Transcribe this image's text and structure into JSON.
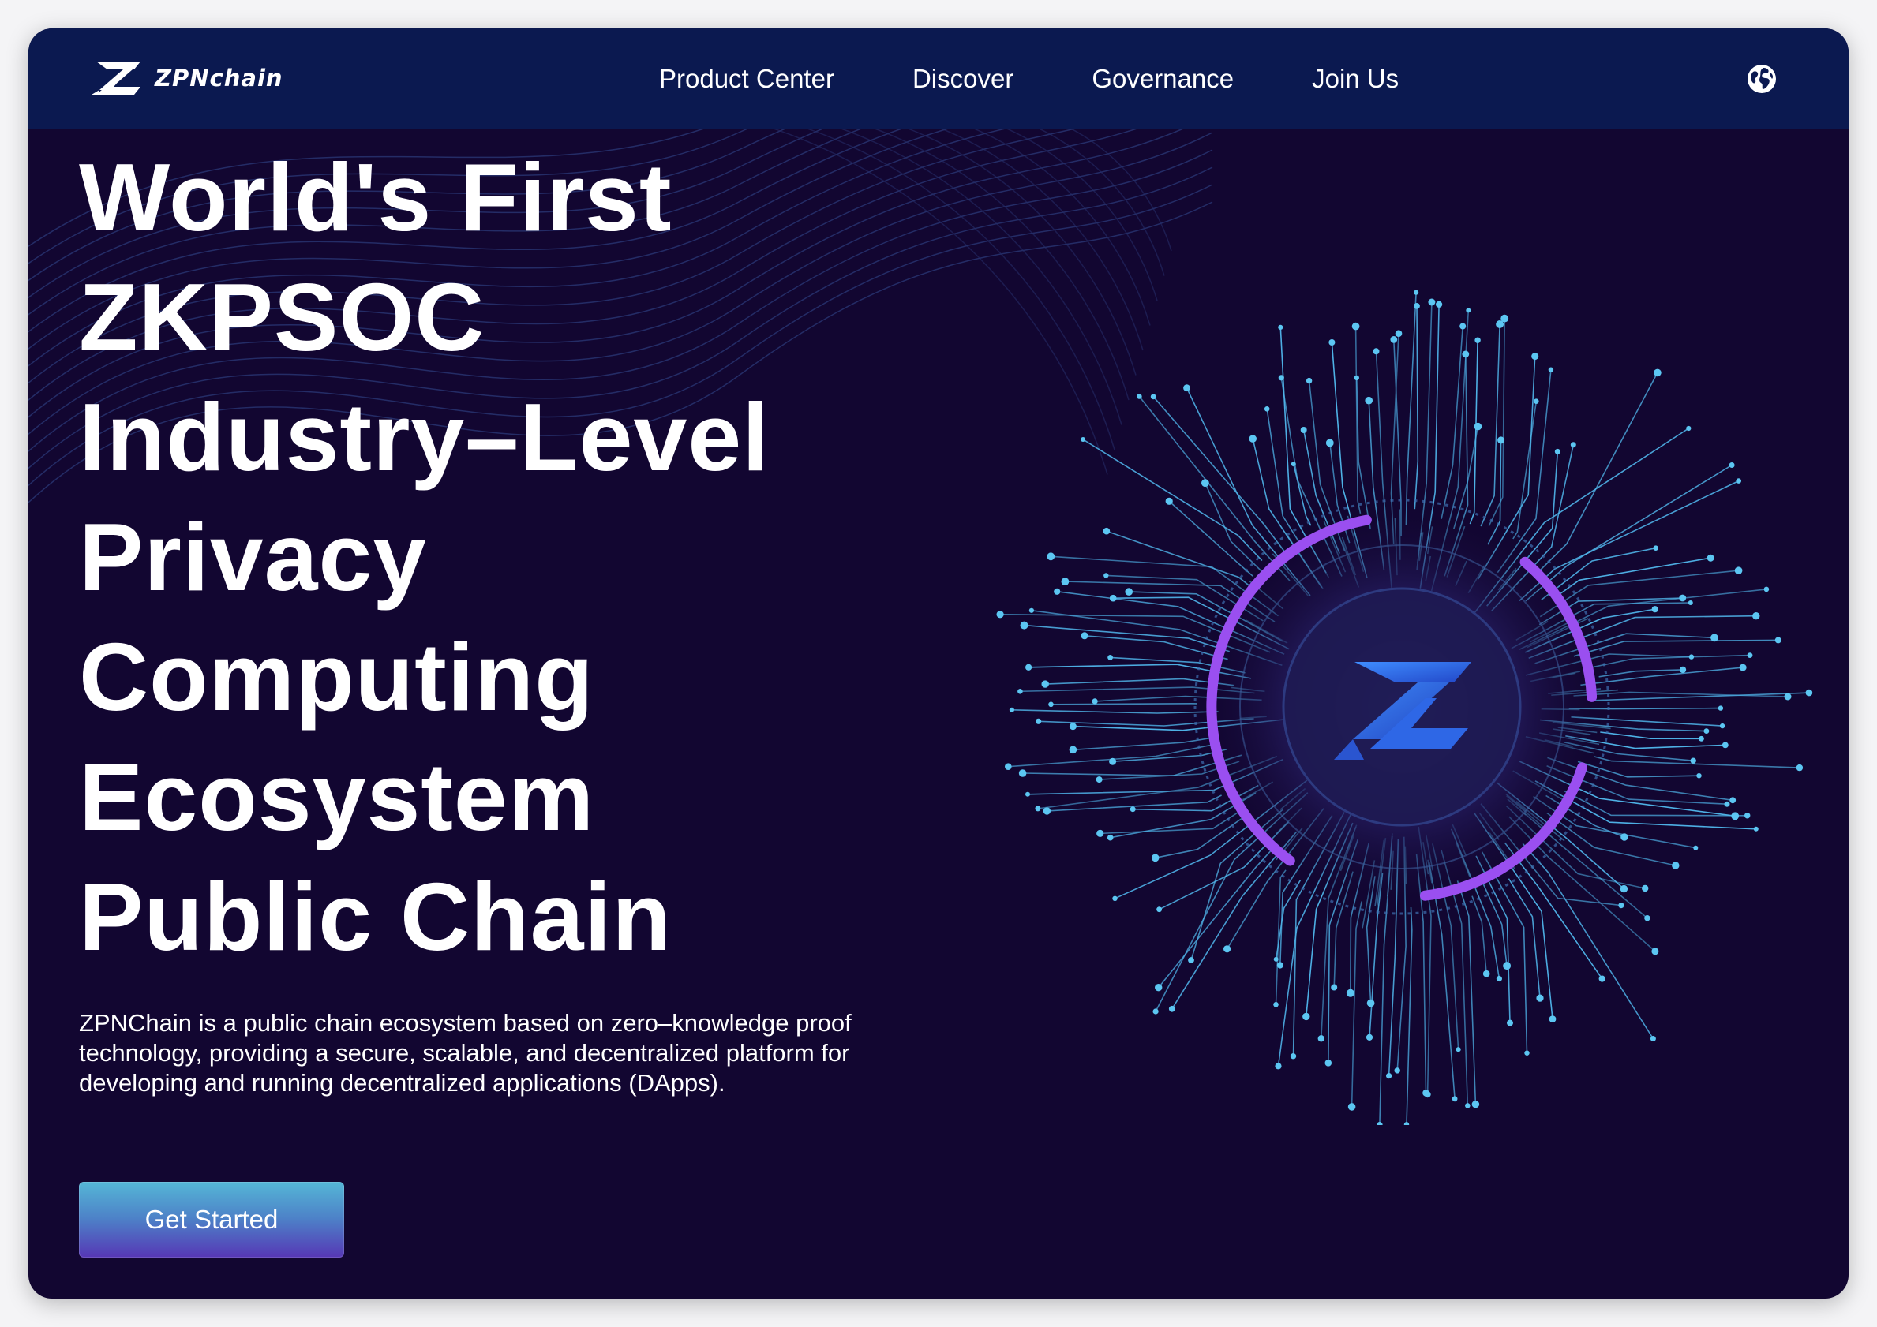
{
  "brand": {
    "name": "ZPNchain"
  },
  "nav": {
    "items": [
      {
        "label": "Product Center"
      },
      {
        "label": "Discover"
      },
      {
        "label": "Governance"
      },
      {
        "label": "Join Us"
      }
    ],
    "language_icon": "globe-icon"
  },
  "hero": {
    "title_lines": [
      "World's First",
      "ZKPSOC",
      "Industry–Level",
      "Privacy",
      "Computing",
      "Ecosystem",
      "Public Chain"
    ],
    "description": "ZPNChain is a public chain ecosystem based on zero–knowledge proof technology, providing a secure, scalable, and decentralized platform for developing and running decentralized applications (DApps).",
    "cta_label": "Get Started"
  },
  "colors": {
    "background": "#120631",
    "navbar": "#0b1950",
    "circuit": "#4fb3e8",
    "ring": "#9a4ff0",
    "text": "#ffffff"
  }
}
